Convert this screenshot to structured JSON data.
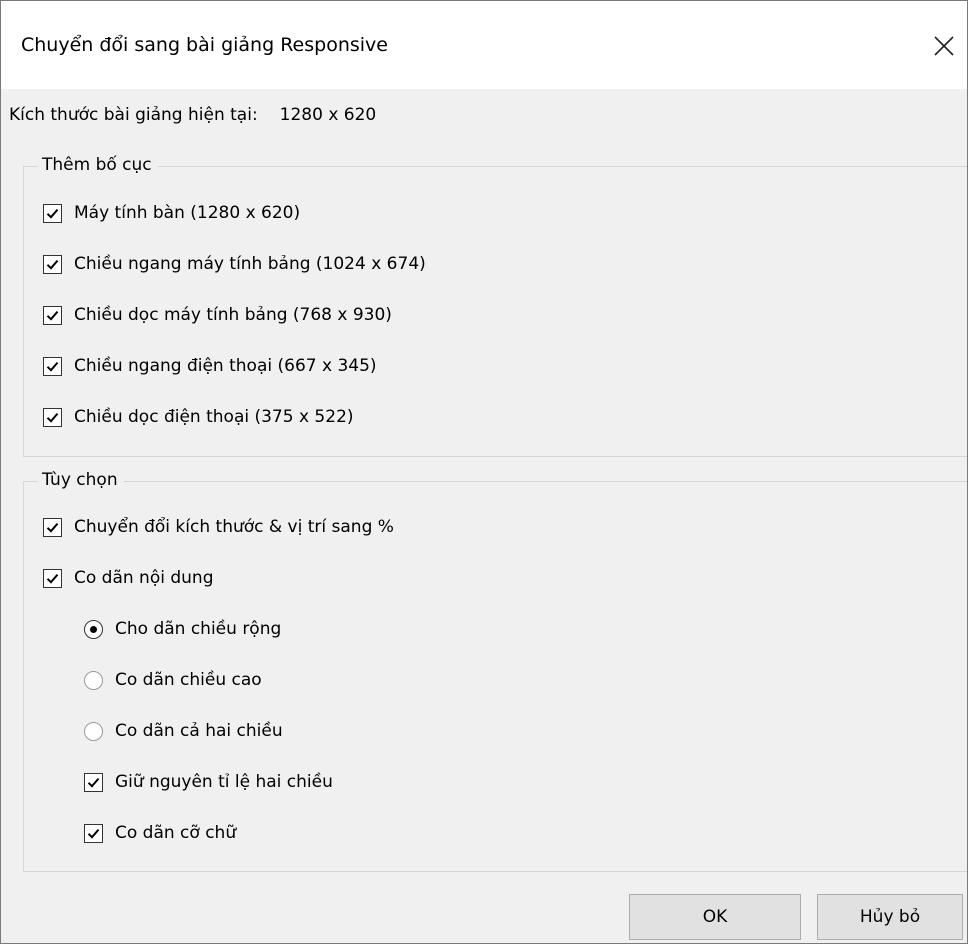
{
  "dialog": {
    "title": "Chuyển đổi sang bài giảng Responsive",
    "current_size_label": "Kích thước bài giảng hiện tại:",
    "current_size_value": "1280 x 620"
  },
  "layouts_group": {
    "legend": "Thêm bố cục",
    "items": [
      {
        "label": "Máy tính bàn (1280 x 620)",
        "checked": true
      },
      {
        "label": "Chiều ngang máy tính bảng (1024 x 674)",
        "checked": true
      },
      {
        "label": "Chiều dọc máy tính bảng (768 x 930)",
        "checked": true
      },
      {
        "label": "Chiều ngang điện thoại (667 x 345)",
        "checked": true
      },
      {
        "label": "Chiều dọc điện thoại (375 x 522)",
        "checked": true
      }
    ]
  },
  "options_group": {
    "legend": "Tùy chọn",
    "convert_percent": {
      "label": "Chuyển đổi kích thước & vị trí sang %",
      "checked": true
    },
    "scale_content": {
      "label": "Co dãn nội dung",
      "checked": true
    },
    "scale_modes": [
      {
        "label": "Cho dãn chiều rộng",
        "selected": true
      },
      {
        "label": "Co dãn chiều cao",
        "selected": false
      },
      {
        "label": "Co dãn cả hai chiều",
        "selected": false
      }
    ],
    "keep_ratio": {
      "label": "Giữ nguyên tỉ lệ hai chiều",
      "checked": true
    },
    "scale_font": {
      "label": "Co dãn cỡ chữ",
      "checked": true
    }
  },
  "buttons": {
    "ok_label": "OK",
    "cancel_label": "Hủy bỏ"
  },
  "icons": {
    "close": "close-icon",
    "check": "checkmark-icon",
    "radio_dot": "radio-dot-icon"
  },
  "colors": {
    "title_bar": "#ffffff",
    "dialog_bg": "#f0f0f0",
    "button_bg": "#e1e1e1",
    "group_border": "#d5d5d5"
  }
}
